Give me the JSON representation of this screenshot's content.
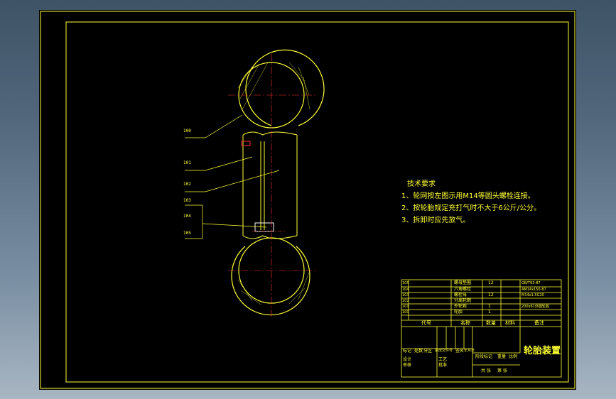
{
  "drawing": {
    "part_labels": [
      "100",
      "101",
      "102",
      "103",
      "104",
      "105"
    ],
    "notes": {
      "title": "技术要求",
      "lines": [
        "1、轮网按左图示用M14等圆头螺栓连接。",
        "2、按轮胎规定充打气时不大于6公斤/公分。",
        "3、拆卸时应先放气。"
      ]
    },
    "title_block": {
      "drawing_title": "轮胎装置",
      "parts_rows": [
        {
          "no": "105",
          "name": "螺母垫圈",
          "code": "",
          "qty": "12",
          "material": "GB/T93-87",
          "remark": ""
        },
        {
          "no": "104",
          "name": "六角螺栓",
          "code": "",
          "qty": "",
          "material": "AM14x150-87",
          "remark": ""
        },
        {
          "no": "103",
          "name": "螺栓母",
          "code": "",
          "qty": "12",
          "material": "M14x1.5G20",
          "remark": ""
        },
        {
          "no": "102",
          "name": "分离轮辋",
          "code": "",
          "qty": "",
          "material": "",
          "remark": ""
        },
        {
          "no": "101",
          "name": "外轮毂",
          "code": "",
          "qty": "1",
          "material": "200x61外圆轮毂",
          "remark": ""
        },
        {
          "no": "100",
          "name": "轮胎",
          "code": "",
          "qty": "1",
          "material": "",
          "remark": ""
        }
      ],
      "header": {
        "code": "代号",
        "name": "名称",
        "qty": "数量",
        "material": "材料",
        "remark": "备注"
      },
      "sign_labels": [
        "标记",
        "处数",
        "分区",
        "更改文件号",
        "签名",
        "年月日"
      ],
      "role_labels": [
        "设计",
        "审核",
        "工艺",
        "批准"
      ],
      "stage_labels": [
        "阶段标记",
        "重量",
        "比例"
      ],
      "sheet_labels": [
        "共 张",
        "第 张"
      ]
    }
  }
}
